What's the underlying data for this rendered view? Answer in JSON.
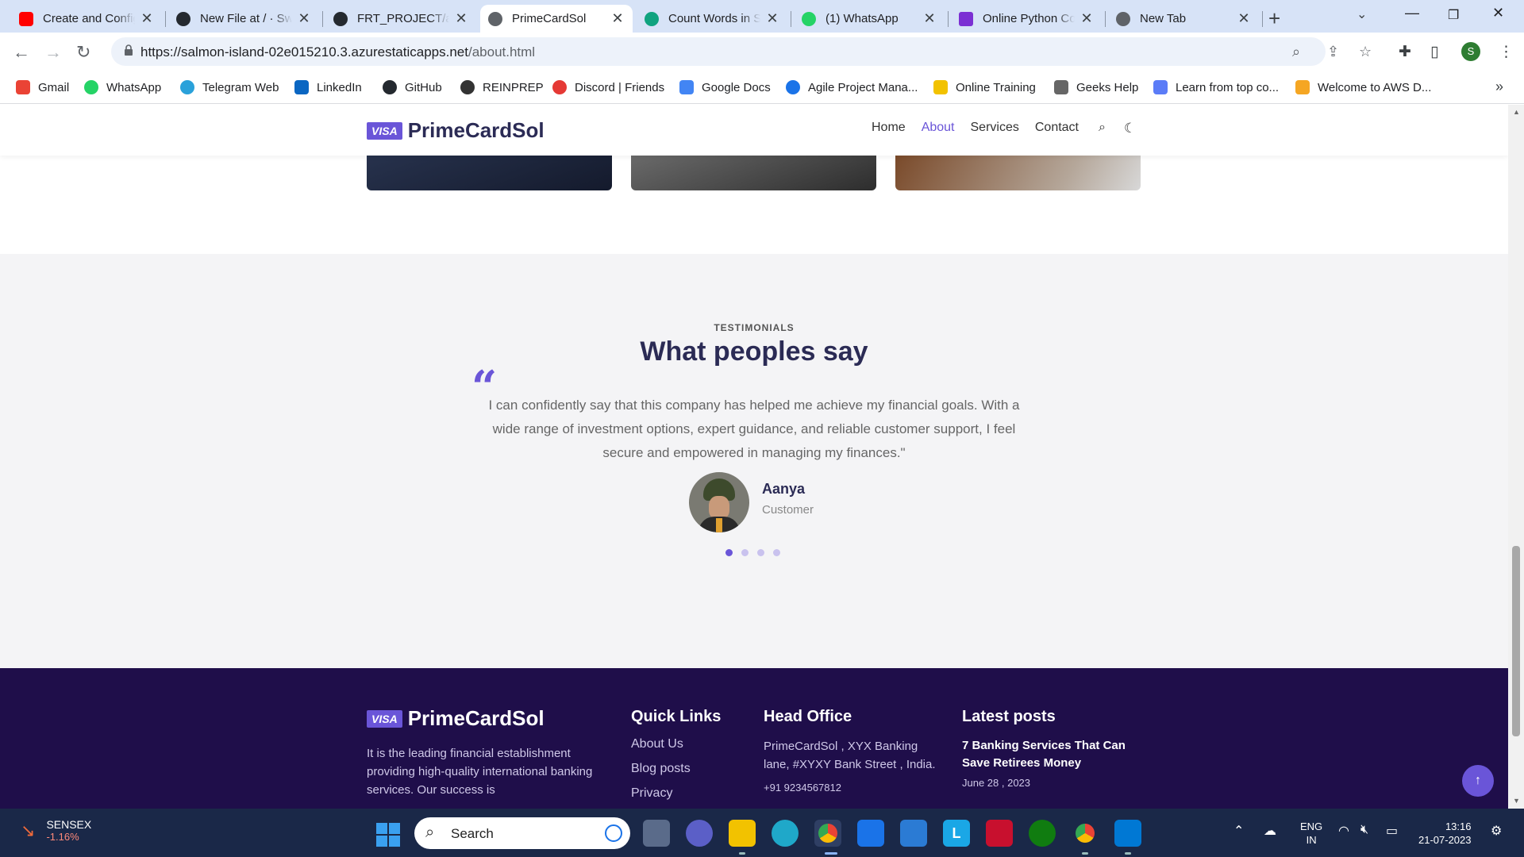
{
  "tabs": [
    {
      "title": "Create and Config",
      "color": "#ff0000"
    },
    {
      "title": "New File at / · Sw",
      "color": "#24292f"
    },
    {
      "title": "FRT_PROJECT/ass",
      "color": "#24292f"
    },
    {
      "title": "PrimeCardSol",
      "color": "#5f6368"
    },
    {
      "title": "Count Words in S",
      "color": "#10a37f"
    },
    {
      "title": "(1) WhatsApp",
      "color": "#25d366"
    },
    {
      "title": "Online Python Co",
      "color": "#7b2fd3"
    },
    {
      "title": "New Tab",
      "color": "#5f6368"
    }
  ],
  "address": {
    "url_main": "https://salmon-island-02e015210.3.azurestaticapps.net",
    "url_path": "/about.html"
  },
  "bookmarks": [
    {
      "label": "Gmail",
      "color": "#ea4335"
    },
    {
      "label": "WhatsApp",
      "color": "#25d366"
    },
    {
      "label": "Telegram Web",
      "color": "#2aa1da"
    },
    {
      "label": "LinkedIn",
      "color": "#0a66c2"
    },
    {
      "label": "GitHub",
      "color": "#24292f"
    },
    {
      "label": "REINPREP",
      "color": "#333333"
    },
    {
      "label": "Discord | Friends",
      "color": "#e53935"
    },
    {
      "label": "Google Docs",
      "color": "#4285f4"
    },
    {
      "label": "Agile Project Mana...",
      "color": "#1a73e8"
    },
    {
      "label": "Online Training",
      "color": "#f2c200"
    },
    {
      "label": "Geeks Help",
      "color": "#666666"
    },
    {
      "label": "Learn from top co...",
      "color": "#5b7cf7"
    },
    {
      "label": "Welcome to AWS D...",
      "color": "#f5a623"
    }
  ],
  "site": {
    "visa_badge": "VISA",
    "brand": "PrimeCardSol",
    "nav": [
      "Home",
      "About",
      "Services",
      "Contact"
    ],
    "accent": "#6a55d8"
  },
  "testimonials": {
    "kicker": "TESTIMONIALS",
    "title": "What peoples say",
    "quote": "I can confidently say that this company has helped me achieve my financial goals. With a wide range of investment options, expert guidance, and reliable customer support, I feel secure and empowered in managing my finances.\"",
    "name": "Aanya",
    "role": "Customer"
  },
  "footer": {
    "brand": "PrimeCardSol",
    "about": "It is the leading financial establishment providing high-quality international banking services. Our success is",
    "quick_links_title": "Quick Links",
    "quick_links": [
      "About Us",
      "Blog posts",
      "Privacy"
    ],
    "office_title": "Head Office",
    "office_text": "PrimeCardSol , XYX Banking lane, #XYXY Bank Street , India.",
    "office_phone": "+91 9234567812",
    "posts_title": "Latest posts",
    "post_title": "7 Banking Services That Can Save Retirees Money",
    "post_date": "June 28 , 2023"
  },
  "taskbar": {
    "stock_name": "SENSEX",
    "stock_change": "-1.16%",
    "search_label": "Search",
    "lang_1": "ENG",
    "lang_2": "IN",
    "time": "13:16",
    "date": "21-07-2023"
  }
}
